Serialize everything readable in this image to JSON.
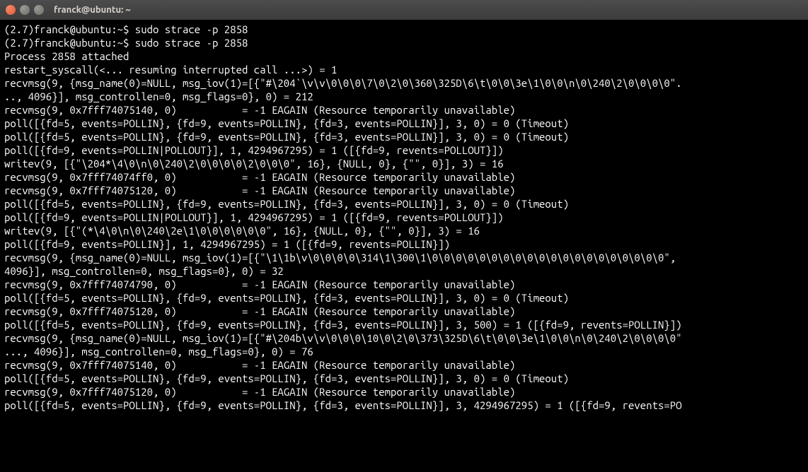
{
  "window": {
    "title": "franck@ubuntu: ~"
  },
  "terminal": {
    "prompt_py": "(2.7)",
    "prompt_user": "franck@ubuntu",
    "prompt_path": "~",
    "prompt_sym": "$",
    "command": "sudo strace -p 2858",
    "lines": [
      "(2.7)franck@ubuntu:~$ sudo strace -p 2858",
      "(2.7)franck@ubuntu:~$ sudo strace -p 2858",
      "Process 2858 attached",
      "restart_syscall(<... resuming interrupted call ...>) = 1",
      "recvmsg(9, {msg_name(0)=NULL, msg_iov(1)=[{\"#\\204`\\v\\v\\0\\0\\0\\7\\0\\2\\0\\360\\325D\\6\\t\\0\\0\\3e\\1\\0\\0\\n\\0\\240\\2\\0\\0\\0\\0\".",
      ".., 4096}], msg_controllen=0, msg_flags=0}, 0) = 212",
      "recvmsg(9, 0x7fff74075140, 0)           = -1 EAGAIN (Resource temporarily unavailable)",
      "poll([{fd=5, events=POLLIN}, {fd=9, events=POLLIN}, {fd=3, events=POLLIN}], 3, 0) = 0 (Timeout)",
      "poll([{fd=5, events=POLLIN}, {fd=9, events=POLLIN}, {fd=3, events=POLLIN}], 3, 0) = 0 (Timeout)",
      "poll([{fd=9, events=POLLIN|POLLOUT}], 1, 4294967295) = 1 ([{fd=9, revents=POLLOUT}])",
      "writev(9, [{\"\\204*\\4\\0\\n\\0\\240\\2\\0\\0\\0\\0\\2\\0\\0\\0\", 16}, {NULL, 0}, {\"\", 0}], 3) = 16",
      "recvmsg(9, 0x7fff74074ff0, 0)           = -1 EAGAIN (Resource temporarily unavailable)",
      "recvmsg(9, 0x7fff74075120, 0)           = -1 EAGAIN (Resource temporarily unavailable)",
      "poll([{fd=5, events=POLLIN}, {fd=9, events=POLLIN}, {fd=3, events=POLLIN}], 3, 0) = 0 (Timeout)",
      "poll([{fd=9, events=POLLIN|POLLOUT}], 1, 4294967295) = 1 ([{fd=9, revents=POLLOUT}])",
      "writev(9, [{\"(*\\4\\0\\n\\0\\240\\2e\\1\\0\\0\\0\\0\\0\\0\", 16}, {NULL, 0}, {\"\", 0}], 3) = 16",
      "poll([{fd=9, events=POLLIN}], 1, 4294967295) = 1 ([{fd=9, revents=POLLIN}])",
      "recvmsg(9, {msg_name(0)=NULL, msg_iov(1)=[{\"\\1\\1b\\v\\0\\0\\0\\0\\314\\1\\300\\1\\0\\0\\0\\0\\0\\0\\0\\0\\0\\0\\0\\0\\0\\0\\0\\0\\0\\0\\0\\0\",",
      "4096}], msg_controllen=0, msg_flags=0}, 0) = 32",
      "recvmsg(9, 0x7fff74074790, 0)           = -1 EAGAIN (Resource temporarily unavailable)",
      "poll([{fd=5, events=POLLIN}, {fd=9, events=POLLIN}, {fd=3, events=POLLIN}], 3, 0) = 0 (Timeout)",
      "recvmsg(9, 0x7fff74075120, 0)           = -1 EAGAIN (Resource temporarily unavailable)",
      "poll([{fd=5, events=POLLIN}, {fd=9, events=POLLIN}, {fd=3, events=POLLIN}], 3, 500) = 1 ([{fd=9, revents=POLLIN}])",
      "recvmsg(9, {msg_name(0)=NULL, msg_iov(1)=[{\"#\\204b\\v\\v\\0\\0\\0\\10\\0\\2\\0\\373\\325D\\6\\t\\0\\0\\3e\\1\\0\\0\\n\\0\\240\\2\\0\\0\\0\\0\"",
      "..., 4096}], msg_controllen=0, msg_flags=0}, 0) = 76",
      "recvmsg(9, 0x7fff74075140, 0)           = -1 EAGAIN (Resource temporarily unavailable)",
      "poll([{fd=5, events=POLLIN}, {fd=9, events=POLLIN}, {fd=3, events=POLLIN}], 3, 0) = 0 (Timeout)",
      "recvmsg(9, 0x7fff74075120, 0)           = -1 EAGAIN (Resource temporarily unavailable)",
      "poll([{fd=5, events=POLLIN}, {fd=9, events=POLLIN}, {fd=3, events=POLLIN}], 3, 4294967295) = 1 ([{fd=9, revents=PO"
    ]
  }
}
